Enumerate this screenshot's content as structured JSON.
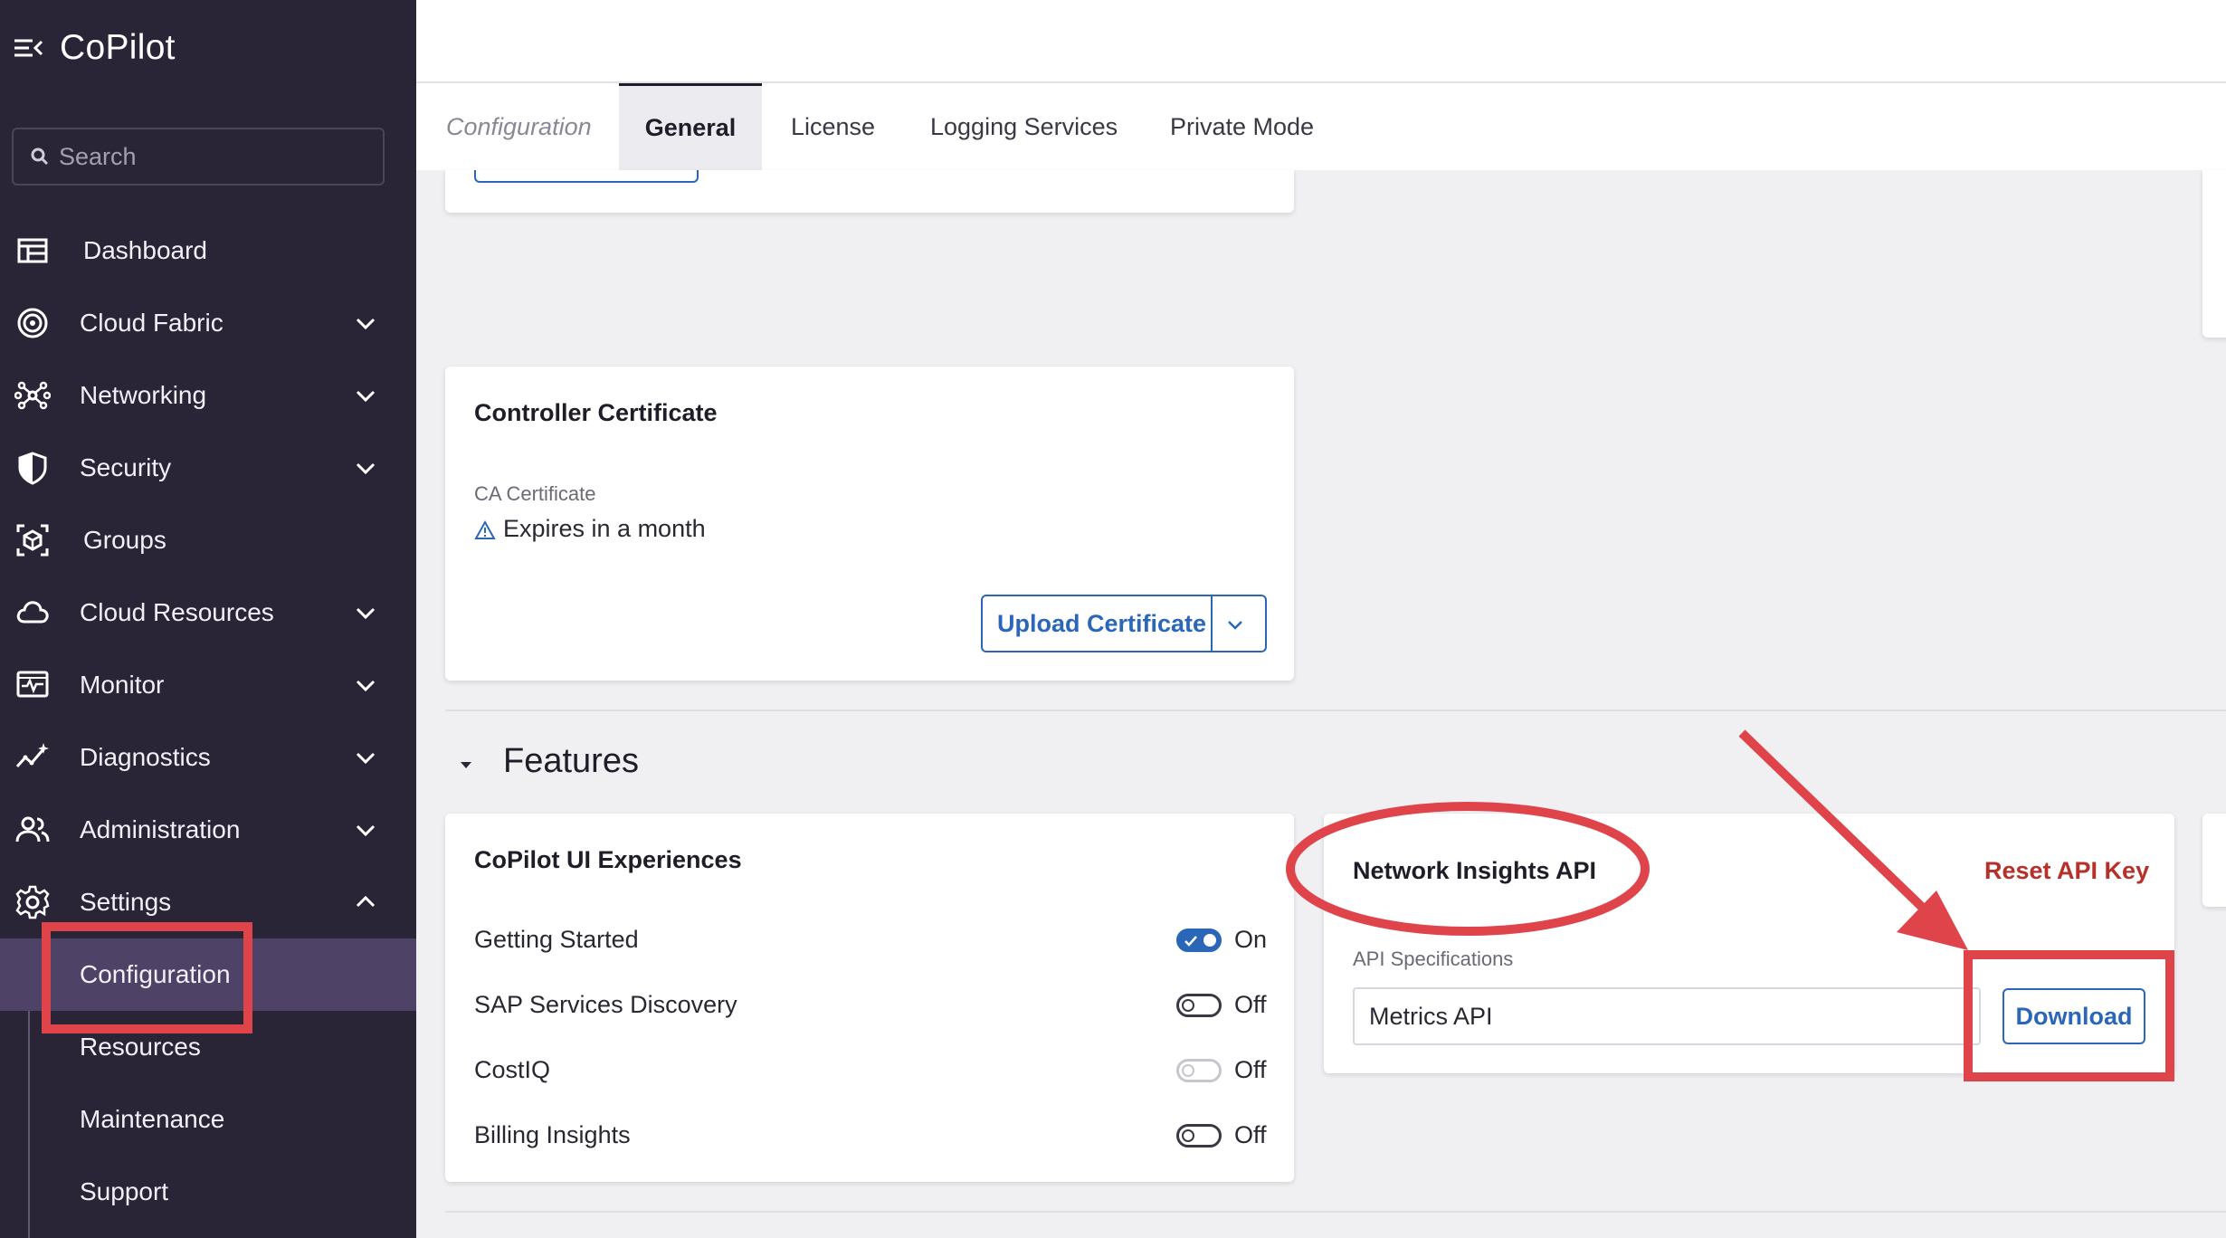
{
  "app": {
    "title": "CoPilot"
  },
  "search": {
    "placeholder": "Search"
  },
  "sidebar": {
    "items": [
      {
        "label": "Dashboard",
        "icon": "dashboard-icon"
      },
      {
        "label": "Cloud Fabric",
        "icon": "cloud-fabric-icon"
      },
      {
        "label": "Networking",
        "icon": "networking-icon"
      },
      {
        "label": "Security",
        "icon": "shield-icon"
      },
      {
        "label": "Groups",
        "icon": "groups-icon"
      },
      {
        "label": "Cloud Resources",
        "icon": "cloud-icon"
      },
      {
        "label": "Monitor",
        "icon": "monitor-icon"
      },
      {
        "label": "Diagnostics",
        "icon": "diagnostics-icon"
      },
      {
        "label": "Administration",
        "icon": "administration-icon"
      },
      {
        "label": "Settings",
        "icon": "gear-icon"
      }
    ],
    "sub_items": [
      {
        "label": "Configuration"
      },
      {
        "label": "Resources"
      },
      {
        "label": "Maintenance"
      },
      {
        "label": "Support"
      }
    ]
  },
  "tabs": [
    {
      "label": "Configuration"
    },
    {
      "label": "General"
    },
    {
      "label": "License"
    },
    {
      "label": "Logging Services"
    },
    {
      "label": "Private Mode"
    }
  ],
  "controller_certificate": {
    "title": "Controller Certificate",
    "ca_label": "CA Certificate",
    "status": "Expires in a month",
    "upload_label": "Upload Certificate"
  },
  "features": {
    "title": "Features",
    "ui_experiences": {
      "title": "CoPilot UI Experiences",
      "toggles": [
        {
          "label": "Getting Started",
          "state": "On"
        },
        {
          "label": "SAP Services Discovery",
          "state": "Off"
        },
        {
          "label": "CostIQ",
          "state": "Off"
        },
        {
          "label": "Billing Insights",
          "state": "Off"
        }
      ]
    },
    "network_insights": {
      "title": "Network Insights API",
      "reset_label": "Reset API Key",
      "spec_label": "API Specifications",
      "spec_value": "Metrics API",
      "download_label": "Download"
    }
  },
  "colors": {
    "sidebar_bg": "#2a2536",
    "accent_blue": "#2b67b8",
    "reset_red": "#b5312a",
    "annotation_red": "#e0444b"
  }
}
